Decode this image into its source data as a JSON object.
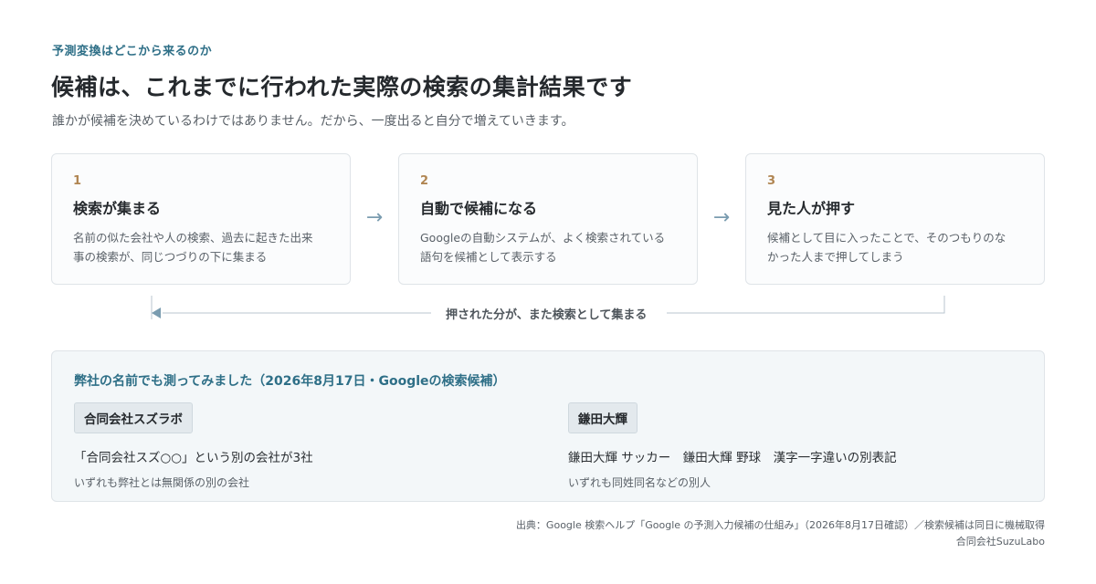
{
  "eyebrow": "予測変換はどこから来るのか",
  "title": "候補は、これまでに行われた実際の検索の集計結果です",
  "subtitle": "誰かが候補を決めているわけではありません。だから、一度出ると自分で増えていきます。",
  "steps": [
    {
      "num": "1",
      "head": "検索が集まる",
      "body_line1": "名前の似た会社や人の検索、過去に起きた出来",
      "body_line2": "事の検索が、同じつづりの下に集まる"
    },
    {
      "num": "2",
      "head": "自動で候補になる",
      "body_line1": "Googleの自動システムが、よく検索されている",
      "body_line2": "語句を候補として表示する"
    },
    {
      "num": "3",
      "head": "見た人が押す",
      "body_line1": "候補として目に入ったことで、そのつもりのな",
      "body_line2": "かった人まで押してしまう"
    }
  ],
  "arrow_glyph": "→",
  "loop_label": "押された分が、また検索として集まる",
  "panel": {
    "title": "弊社の名前でも測ってみました（2026年8月17日・Googleの検索候補）",
    "left": {
      "chip": "合同会社スズラボ",
      "line": "「合同会社スズ○○」という別の会社が3社",
      "note": "いずれも弊社とは無関係の別の会社"
    },
    "right": {
      "chip": "鎌田大輝",
      "line": "鎌田大輝 サッカー　鎌田大輝 野球　漢字一字違いの別表記",
      "note": "いずれも同姓同名などの別人"
    }
  },
  "source": "出典：Google 検索ヘルプ「Google の予測入力候補の仕組み」（2026年8月17日確認）／検索候補は同日に機械取得",
  "company": "合同会社SuzuLabo",
  "colors": {
    "accent": "#2e6f87",
    "step_number": "#b08552",
    "arrow": "#7a9cb0"
  }
}
